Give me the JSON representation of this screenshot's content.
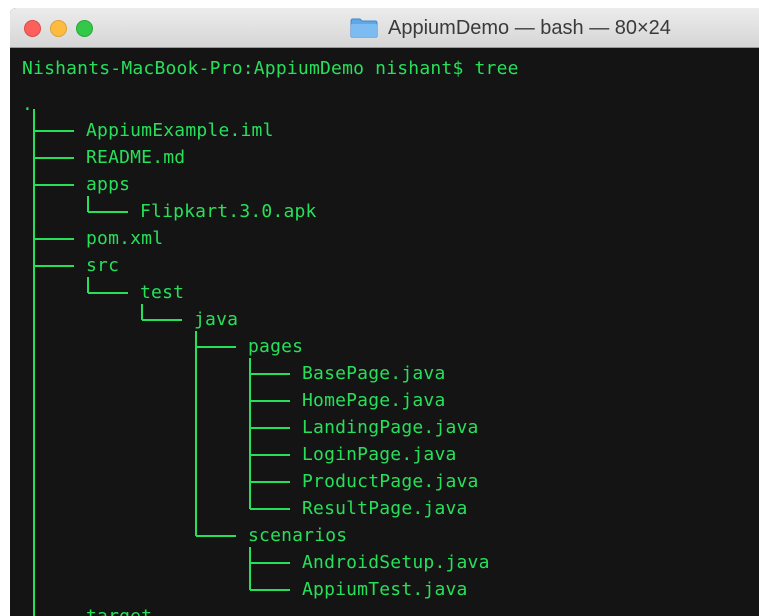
{
  "window": {
    "title": "AppiumDemo — bash — 80×24",
    "folder_icon": "folder-icon",
    "traffic_lights": [
      "close",
      "minimize",
      "zoom"
    ],
    "colors": {
      "terminal_bg": "#141414",
      "text": "#27e05a"
    }
  },
  "terminal": {
    "prompt": "Nishants-MacBook-Pro:AppiumDemo nishant$ tree",
    "root": ".",
    "tree": [
      {
        "name": "AppiumExample.iml",
        "depth": 0
      },
      {
        "name": "README.md",
        "depth": 0
      },
      {
        "name": "apps",
        "depth": 0
      },
      {
        "name": "Flipkart.3.0.apk",
        "depth": 1
      },
      {
        "name": "pom.xml",
        "depth": 0
      },
      {
        "name": "src",
        "depth": 0
      },
      {
        "name": "test",
        "depth": 1
      },
      {
        "name": "java",
        "depth": 2
      },
      {
        "name": "pages",
        "depth": 3
      },
      {
        "name": "BasePage.java",
        "depth": 4
      },
      {
        "name": "HomePage.java",
        "depth": 4
      },
      {
        "name": "LandingPage.java",
        "depth": 4
      },
      {
        "name": "LoginPage.java",
        "depth": 4
      },
      {
        "name": "ProductPage.java",
        "depth": 4
      },
      {
        "name": "ResultPage.java",
        "depth": 4
      },
      {
        "name": "scenarios",
        "depth": 3
      },
      {
        "name": "AndroidSetup.java",
        "depth": 4
      },
      {
        "name": "AppiumTest.java",
        "depth": 4
      },
      {
        "name": "target",
        "depth": 0
      }
    ]
  }
}
